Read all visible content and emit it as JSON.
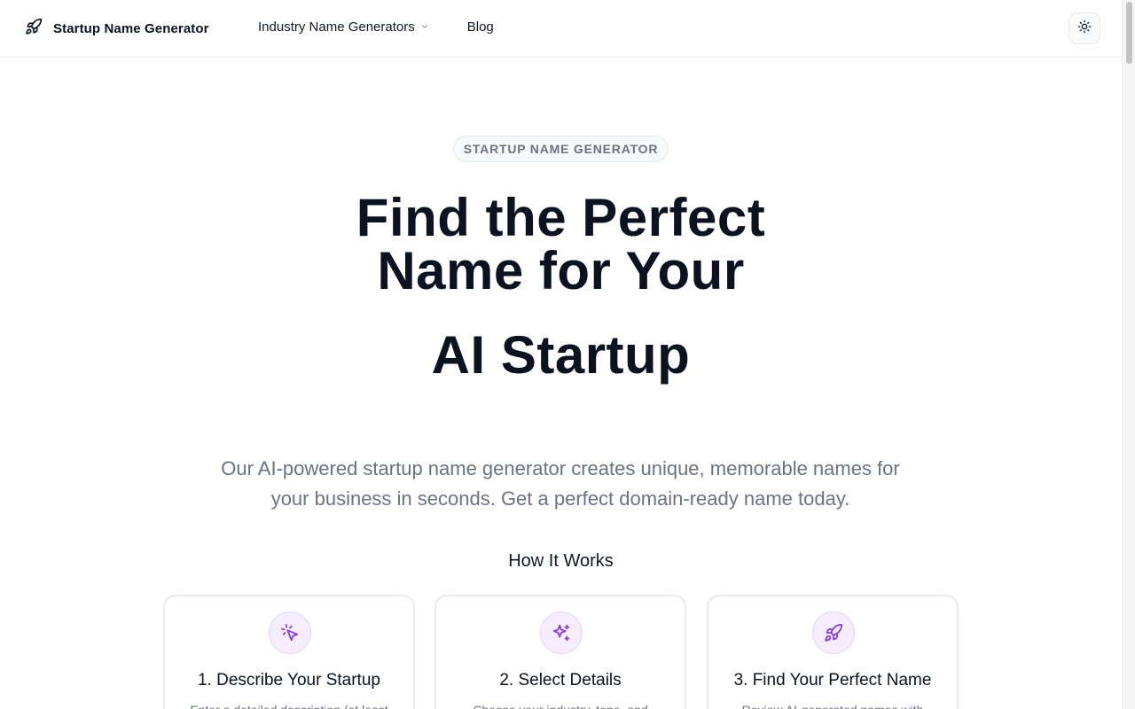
{
  "header": {
    "brand_name": "Startup Name Generator",
    "brand_icon": "rocket-icon",
    "nav": {
      "industry_label": "Industry Name Generators",
      "blog_label": "Blog"
    },
    "theme_toggle_icon": "sun-icon"
  },
  "hero": {
    "badge": "STARTUP NAME GENERATOR",
    "title_line1": "Find the Perfect",
    "title_line2": "Name for Your",
    "title_line3": "AI Startup",
    "subtitle": "Our AI-powered startup name generator creates unique, memorable names for your business in seconds. Get a perfect domain-ready name today."
  },
  "how_it_works": {
    "title": "How It Works",
    "steps": [
      {
        "title": "1. Describe Your Startup",
        "description": "Enter a detailed description (at least",
        "icon": "cursor-click-icon"
      },
      {
        "title": "2. Select Details",
        "description": "Choose your industry, tone, and",
        "icon": "sparkles-icon"
      },
      {
        "title": "3. Find Your Perfect Name",
        "description": "Review AI-generated names with",
        "icon": "rocket-icon"
      }
    ]
  },
  "colors": {
    "accent_purple": "#8b3fd9",
    "icon_bg": "#f5ecfd",
    "text_dark": "#0b1220",
    "text_muted": "#6b7280"
  }
}
